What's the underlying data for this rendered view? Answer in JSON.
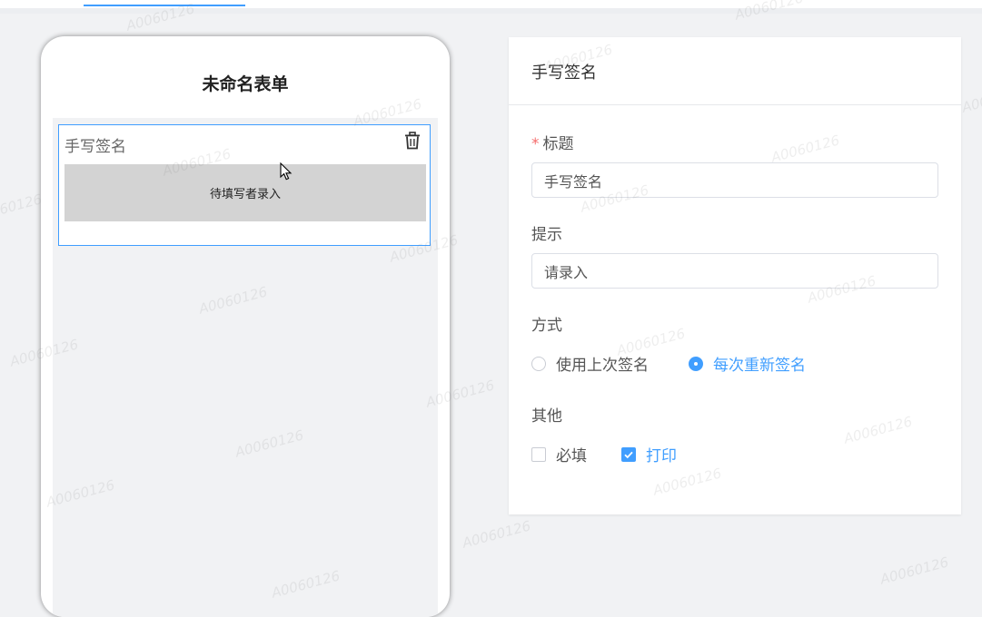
{
  "form": {
    "title": "未命名表单",
    "field": {
      "label": "手写签名",
      "pad_text": "待填写者录入"
    }
  },
  "panel": {
    "title": "手写签名",
    "title_field": {
      "required_mark": "*",
      "label": "标题",
      "value": "手写签名"
    },
    "hint_field": {
      "label": "提示",
      "value": "请录入"
    },
    "mode": {
      "label": "方式",
      "options": [
        {
          "label": "使用上次签名",
          "selected": false
        },
        {
          "label": "每次重新签名",
          "selected": true
        }
      ]
    },
    "other": {
      "label": "其他",
      "options": [
        {
          "label": "必填",
          "checked": false
        },
        {
          "label": "打印",
          "checked": true
        }
      ]
    }
  },
  "watermark": "A0060126",
  "colors": {
    "accent": "#409eff",
    "required": "#f56c6c",
    "pad": "#d3d3d3"
  }
}
